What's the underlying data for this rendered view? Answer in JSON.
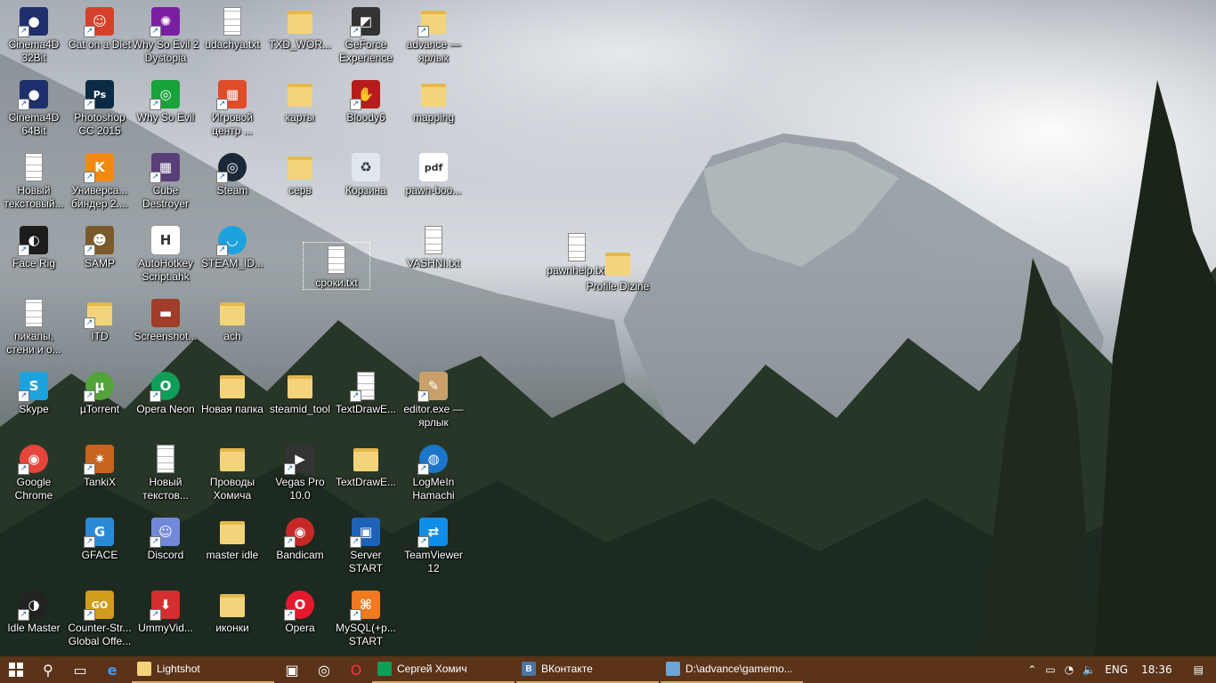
{
  "colors": {
    "taskbar": "#5a3319",
    "active_underline": "#d7a36e"
  },
  "desktop_icons": [
    {
      "label": "Cinema4D\n32Bit",
      "icon": "cinema4d-icon",
      "shortcut": true,
      "color": "#1f2f6b",
      "glyph": "●"
    },
    {
      "label": "Cinema4D\n64Bit",
      "icon": "cinema4d-icon",
      "shortcut": true,
      "color": "#1f2f6b",
      "glyph": "●"
    },
    {
      "label": "Новый\nтекстовый...",
      "icon": "text-file-icon",
      "shortcut": false,
      "type": "doc"
    },
    {
      "label": "Face Rig",
      "icon": "facerig-icon",
      "shortcut": true,
      "color": "#1c1c1c",
      "glyph": "◐"
    },
    {
      "label": "пикапы,\nстени и о...",
      "icon": "text-file-icon",
      "shortcut": false,
      "type": "doc"
    },
    {
      "label": "Skype",
      "icon": "skype-icon",
      "shortcut": true,
      "color": "#1ea2de",
      "glyph": "S"
    },
    {
      "label": "Google\nChrome",
      "icon": "chrome-icon",
      "shortcut": true,
      "color": "#e6453c",
      "glyph": "◉",
      "circle": true
    },
    {
      "label": "Idle Master",
      "icon": "idle-master-icon",
      "shortcut": true,
      "color": "#222",
      "glyph": "◑",
      "circle": true
    },
    {
      "label": "Cat on a Diet",
      "icon": "cat-on-a-diet-icon",
      "shortcut": true,
      "color": "#d6402a",
      "glyph": "☺"
    },
    {
      "label": "Photoshop\nCC 2015",
      "icon": "photoshop-icon",
      "shortcut": true,
      "color": "#0b2a43",
      "glyph": "Ps"
    },
    {
      "label": "Универса...\nбиндер 2....",
      "icon": "binder-icon",
      "shortcut": true,
      "color": "#f08a10",
      "glyph": "K"
    },
    {
      "label": "SAMP",
      "icon": "samp-icon",
      "shortcut": true,
      "color": "#7a5a2a",
      "glyph": "☻"
    },
    {
      "label": "ITD",
      "icon": "folder-icon",
      "shortcut": true,
      "type": "folder"
    },
    {
      "label": "µTorrent",
      "icon": "utorrent-icon",
      "shortcut": true,
      "color": "#53a33b",
      "glyph": "µ",
      "circle": true
    },
    {
      "label": "TankiX",
      "icon": "tankix-icon",
      "shortcut": true,
      "color": "#c8621e",
      "glyph": "✷"
    },
    {
      "label": "GFACE",
      "icon": "gface-icon",
      "shortcut": true,
      "color": "#2b8ad8",
      "glyph": "G"
    },
    {
      "label": "Counter-Str...\nGlobal Offe...",
      "icon": "csgo-icon",
      "shortcut": true,
      "color": "#d19b1c",
      "glyph": "GO"
    },
    {
      "label": "Why So Evil 2\nDystopia",
      "icon": "why-so-evil-2-icon",
      "shortcut": true,
      "color": "#7b1fa2",
      "glyph": "✺"
    },
    {
      "label": "Why So Evil",
      "icon": "why-so-evil-icon",
      "shortcut": true,
      "color": "#1aa23a",
      "glyph": "◎"
    },
    {
      "label": "Cube\nDestroyer",
      "icon": "cube-destroyer-icon",
      "shortcut": true,
      "color": "#5a3e78",
      "glyph": "▦"
    },
    {
      "label": "AutoHotkey\nScript.ahk",
      "icon": "autohotkey-icon",
      "shortcut": false,
      "color": "#ffffff",
      "glyph": "H",
      "dark": true
    },
    {
      "label": "Screenshot...",
      "icon": "screenshot-icon",
      "shortcut": false,
      "color": "#a03c2a",
      "glyph": "▬"
    },
    {
      "label": "Opera Neon",
      "icon": "opera-neon-icon",
      "shortcut": true,
      "color": "#0f9e57",
      "glyph": "O",
      "circle": true
    },
    {
      "label": "Новый\nтекстов...",
      "icon": "text-file-icon",
      "shortcut": false,
      "type": "doc"
    },
    {
      "label": "Discord",
      "icon": "discord-icon",
      "shortcut": true,
      "color": "#7289da",
      "glyph": "☺"
    },
    {
      "label": "UmmyVid...",
      "icon": "ummy-video-icon",
      "shortcut": true,
      "color": "#d32f2f",
      "glyph": "⬇"
    },
    {
      "label": "udachya.txt",
      "icon": "text-file-icon",
      "shortcut": false,
      "type": "doc"
    },
    {
      "label": "Игровой\nцентр ...",
      "icon": "game-center-icon",
      "shortcut": true,
      "color": "#e04b2a",
      "glyph": "▦"
    },
    {
      "label": "Steam",
      "icon": "steam-icon",
      "shortcut": true,
      "color": "#1b2838",
      "glyph": "◎",
      "circle": true
    },
    {
      "label": "STEAM_ID...",
      "icon": "steam-id-icon",
      "shortcut": true,
      "color": "#1ea2de",
      "glyph": "◡",
      "circle": true
    },
    {
      "label": "ach",
      "icon": "folder-icon",
      "shortcut": false,
      "type": "folder"
    },
    {
      "label": "Новая папка",
      "icon": "folder-icon",
      "shortcut": false,
      "type": "folder"
    },
    {
      "label": "Проводы\nХомича",
      "icon": "folder-icon",
      "shortcut": false,
      "type": "folder"
    },
    {
      "label": "master idle",
      "icon": "folder-icon",
      "shortcut": false,
      "type": "folder"
    },
    {
      "label": "иконки",
      "icon": "folder-icon",
      "shortcut": false,
      "type": "folder"
    },
    {
      "label": "TXD_WOR...",
      "icon": "folder-icon",
      "shortcut": false,
      "type": "folder"
    },
    {
      "label": "карты",
      "icon": "folder-icon",
      "shortcut": false,
      "type": "folder"
    },
    {
      "label": "серв",
      "icon": "folder-icon",
      "shortcut": false,
      "type": "folder"
    },
    {
      "label": "сроки.txt",
      "icon": "text-file-icon",
      "shortcut": false,
      "type": "doc",
      "selected": true
    },
    {
      "label": "steamid_tool",
      "icon": "folder-icon",
      "shortcut": false,
      "type": "folder"
    },
    {
      "label": "Vegas Pro\n10.0",
      "icon": "vegas-pro-icon",
      "shortcut": true,
      "color": "#333",
      "glyph": "▶"
    },
    {
      "label": "Bandicam",
      "icon": "bandicam-icon",
      "shortcut": true,
      "color": "#c62828",
      "glyph": "◉",
      "circle": true
    },
    {
      "label": "Opera",
      "icon": "opera-icon",
      "shortcut": true,
      "color": "#e5192e",
      "glyph": "O",
      "circle": true
    },
    {
      "label": "GeForce\nExperience",
      "icon": "geforce-icon",
      "shortcut": true,
      "color": "#333",
      "glyph": "◩"
    },
    {
      "label": "Bloody6",
      "icon": "bloody-icon",
      "shortcut": true,
      "color": "#b71c1c",
      "glyph": "✋"
    },
    {
      "label": "Корзина",
      "icon": "recycle-bin-icon",
      "shortcut": false,
      "color": "#dfe8ee",
      "glyph": "♻",
      "dark": true
    },
    {
      "label": "TextDrawE...",
      "icon": "text-file-icon",
      "shortcut": true,
      "type": "doc"
    },
    {
      "label": "TextDrawE...",
      "icon": "folder-icon",
      "shortcut": false,
      "type": "folder"
    },
    {
      "label": "Server START",
      "icon": "server-start-icon",
      "shortcut": true,
      "color": "#1e62b8",
      "glyph": "▣"
    },
    {
      "label": "MySQL(+p...\nSTART",
      "icon": "mysql-start-icon",
      "shortcut": true,
      "color": "#ef7a1f",
      "glyph": "⌘"
    },
    {
      "label": "advance —\nярлык",
      "icon": "folder-icon",
      "shortcut": true,
      "type": "folder"
    },
    {
      "label": "mapping",
      "icon": "folder-icon",
      "shortcut": false,
      "type": "folder"
    },
    {
      "label": "pawn-boo...",
      "icon": "pdf-file-icon",
      "shortcut": false,
      "color": "#ffffff",
      "glyph": "pdf",
      "dark": true
    },
    {
      "label": "VASHNI.txt",
      "icon": "text-file-icon",
      "shortcut": false,
      "type": "doc"
    },
    {
      "label": "editor.exe —\nярлык",
      "icon": "editor-icon",
      "shortcut": true,
      "color": "#c9a06a",
      "glyph": "✎"
    },
    {
      "label": "LogMeIn\nHamachi",
      "icon": "hamachi-icon",
      "shortcut": true,
      "color": "#1b76c9",
      "glyph": "◍",
      "circle": true
    },
    {
      "label": "TeamViewer\n12",
      "icon": "teamviewer-icon",
      "shortcut": true,
      "color": "#0e8ee9",
      "glyph": "⇄"
    },
    {
      "label": "pawnhelp.txt",
      "icon": "text-file-icon",
      "shortcut": false,
      "type": "doc"
    },
    {
      "label": "Profile Dizine",
      "icon": "folder-icon",
      "shortcut": false,
      "type": "folder"
    }
  ],
  "taskbar": {
    "apps": [
      {
        "label": "Lightshot",
        "icon": "folder-icon",
        "color": "#f3d47a"
      },
      {
        "label": "Сергей Хомич",
        "icon": "opera-neon-icon",
        "color": "#0f9e57"
      },
      {
        "label": "ВКонтакте",
        "icon": "vk-icon",
        "color": "#4a76a8",
        "glyph": "B"
      },
      {
        "label": "D:\\advance\\gamemo...",
        "icon": "notepad-icon",
        "color": "#6aa7d8"
      }
    ],
    "tray": {
      "language": "ENG",
      "time": "18:36"
    }
  }
}
